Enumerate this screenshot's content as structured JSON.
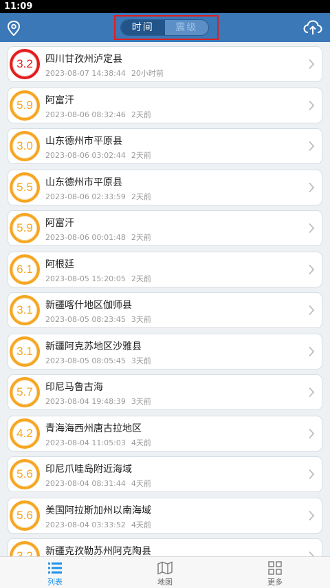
{
  "status": {
    "time": "11:09"
  },
  "header": {
    "segments": [
      {
        "label": "时间",
        "active": true
      },
      {
        "label": "震级",
        "active": false
      }
    ],
    "left_icon": "location-pin-icon",
    "right_icon": "cloud-upload-icon",
    "accent": "#3a78b8"
  },
  "quakes": [
    {
      "mag": "3.2",
      "place": "四川甘孜州泸定县",
      "time": "2023-08-07 14:38:44",
      "ago": "20小时前",
      "level": "red"
    },
    {
      "mag": "5.9",
      "place": "阿富汗",
      "time": "2023-08-06 08:32:46",
      "ago": "2天前",
      "level": "orange"
    },
    {
      "mag": "3.0",
      "place": "山东德州市平原县",
      "time": "2023-08-06 03:02:44",
      "ago": "2天前",
      "level": "orange"
    },
    {
      "mag": "5.5",
      "place": "山东德州市平原县",
      "time": "2023-08-06 02:33:59",
      "ago": "2天前",
      "level": "orange"
    },
    {
      "mag": "5.9",
      "place": "阿富汗",
      "time": "2023-08-06 00:01:48",
      "ago": "2天前",
      "level": "orange"
    },
    {
      "mag": "6.1",
      "place": "阿根廷",
      "time": "2023-08-05 15:20:05",
      "ago": "2天前",
      "level": "orange"
    },
    {
      "mag": "3.1",
      "place": "新疆喀什地区伽师县",
      "time": "2023-08-05 08:23:45",
      "ago": "3天前",
      "level": "orange"
    },
    {
      "mag": "3.1",
      "place": "新疆阿克苏地区沙雅县",
      "time": "2023-08-05 08:05:45",
      "ago": "3天前",
      "level": "orange"
    },
    {
      "mag": "5.7",
      "place": "印尼马鲁古海",
      "time": "2023-08-04 19:48:39",
      "ago": "3天前",
      "level": "orange"
    },
    {
      "mag": "4.2",
      "place": "青海海西州唐古拉地区",
      "time": "2023-08-04 11:05:03",
      "ago": "4天前",
      "level": "orange"
    },
    {
      "mag": "5.6",
      "place": "印尼爪哇岛附近海域",
      "time": "2023-08-04 08:31:44",
      "ago": "4天前",
      "level": "orange"
    },
    {
      "mag": "5.6",
      "place": "美国阿拉斯加州以南海域",
      "time": "2023-08-04 03:33:52",
      "ago": "4天前",
      "level": "orange"
    },
    {
      "mag": "3.2",
      "place": "新疆克孜勒苏州阿克陶县",
      "time": "",
      "ago": "",
      "level": "orange"
    }
  ],
  "tabs": [
    {
      "label": "列表",
      "icon": "list-icon",
      "active": true
    },
    {
      "label": "地图",
      "icon": "map-icon",
      "active": false
    },
    {
      "label": "更多",
      "icon": "grid-more-icon",
      "active": false
    }
  ],
  "colors": {
    "orange": "#f6a623",
    "red": "#e31d1d",
    "tab_active": "#1e90e8"
  }
}
